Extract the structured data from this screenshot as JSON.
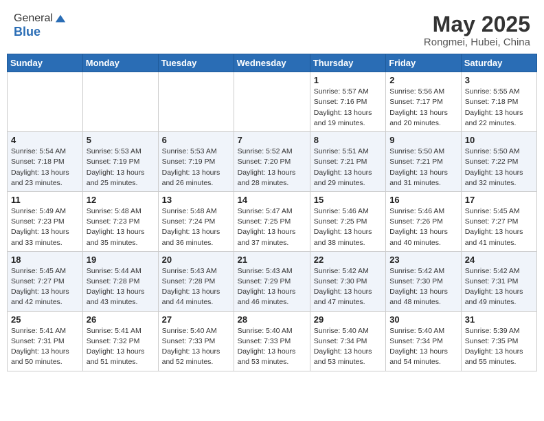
{
  "header": {
    "logo_line1": "General",
    "logo_line2": "Blue",
    "month_title": "May 2025",
    "location": "Rongmei, Hubei, China"
  },
  "days_of_week": [
    "Sunday",
    "Monday",
    "Tuesday",
    "Wednesday",
    "Thursday",
    "Friday",
    "Saturday"
  ],
  "weeks": [
    [
      {
        "day": "",
        "info": ""
      },
      {
        "day": "",
        "info": ""
      },
      {
        "day": "",
        "info": ""
      },
      {
        "day": "",
        "info": ""
      },
      {
        "day": "1",
        "info": "Sunrise: 5:57 AM\nSunset: 7:16 PM\nDaylight: 13 hours\nand 19 minutes."
      },
      {
        "day": "2",
        "info": "Sunrise: 5:56 AM\nSunset: 7:17 PM\nDaylight: 13 hours\nand 20 minutes."
      },
      {
        "day": "3",
        "info": "Sunrise: 5:55 AM\nSunset: 7:18 PM\nDaylight: 13 hours\nand 22 minutes."
      }
    ],
    [
      {
        "day": "4",
        "info": "Sunrise: 5:54 AM\nSunset: 7:18 PM\nDaylight: 13 hours\nand 23 minutes."
      },
      {
        "day": "5",
        "info": "Sunrise: 5:53 AM\nSunset: 7:19 PM\nDaylight: 13 hours\nand 25 minutes."
      },
      {
        "day": "6",
        "info": "Sunrise: 5:53 AM\nSunset: 7:19 PM\nDaylight: 13 hours\nand 26 minutes."
      },
      {
        "day": "7",
        "info": "Sunrise: 5:52 AM\nSunset: 7:20 PM\nDaylight: 13 hours\nand 28 minutes."
      },
      {
        "day": "8",
        "info": "Sunrise: 5:51 AM\nSunset: 7:21 PM\nDaylight: 13 hours\nand 29 minutes."
      },
      {
        "day": "9",
        "info": "Sunrise: 5:50 AM\nSunset: 7:21 PM\nDaylight: 13 hours\nand 31 minutes."
      },
      {
        "day": "10",
        "info": "Sunrise: 5:50 AM\nSunset: 7:22 PM\nDaylight: 13 hours\nand 32 minutes."
      }
    ],
    [
      {
        "day": "11",
        "info": "Sunrise: 5:49 AM\nSunset: 7:23 PM\nDaylight: 13 hours\nand 33 minutes."
      },
      {
        "day": "12",
        "info": "Sunrise: 5:48 AM\nSunset: 7:23 PM\nDaylight: 13 hours\nand 35 minutes."
      },
      {
        "day": "13",
        "info": "Sunrise: 5:48 AM\nSunset: 7:24 PM\nDaylight: 13 hours\nand 36 minutes."
      },
      {
        "day": "14",
        "info": "Sunrise: 5:47 AM\nSunset: 7:25 PM\nDaylight: 13 hours\nand 37 minutes."
      },
      {
        "day": "15",
        "info": "Sunrise: 5:46 AM\nSunset: 7:25 PM\nDaylight: 13 hours\nand 38 minutes."
      },
      {
        "day": "16",
        "info": "Sunrise: 5:46 AM\nSunset: 7:26 PM\nDaylight: 13 hours\nand 40 minutes."
      },
      {
        "day": "17",
        "info": "Sunrise: 5:45 AM\nSunset: 7:27 PM\nDaylight: 13 hours\nand 41 minutes."
      }
    ],
    [
      {
        "day": "18",
        "info": "Sunrise: 5:45 AM\nSunset: 7:27 PM\nDaylight: 13 hours\nand 42 minutes."
      },
      {
        "day": "19",
        "info": "Sunrise: 5:44 AM\nSunset: 7:28 PM\nDaylight: 13 hours\nand 43 minutes."
      },
      {
        "day": "20",
        "info": "Sunrise: 5:43 AM\nSunset: 7:28 PM\nDaylight: 13 hours\nand 44 minutes."
      },
      {
        "day": "21",
        "info": "Sunrise: 5:43 AM\nSunset: 7:29 PM\nDaylight: 13 hours\nand 46 minutes."
      },
      {
        "day": "22",
        "info": "Sunrise: 5:42 AM\nSunset: 7:30 PM\nDaylight: 13 hours\nand 47 minutes."
      },
      {
        "day": "23",
        "info": "Sunrise: 5:42 AM\nSunset: 7:30 PM\nDaylight: 13 hours\nand 48 minutes."
      },
      {
        "day": "24",
        "info": "Sunrise: 5:42 AM\nSunset: 7:31 PM\nDaylight: 13 hours\nand 49 minutes."
      }
    ],
    [
      {
        "day": "25",
        "info": "Sunrise: 5:41 AM\nSunset: 7:31 PM\nDaylight: 13 hours\nand 50 minutes."
      },
      {
        "day": "26",
        "info": "Sunrise: 5:41 AM\nSunset: 7:32 PM\nDaylight: 13 hours\nand 51 minutes."
      },
      {
        "day": "27",
        "info": "Sunrise: 5:40 AM\nSunset: 7:33 PM\nDaylight: 13 hours\nand 52 minutes."
      },
      {
        "day": "28",
        "info": "Sunrise: 5:40 AM\nSunset: 7:33 PM\nDaylight: 13 hours\nand 53 minutes."
      },
      {
        "day": "29",
        "info": "Sunrise: 5:40 AM\nSunset: 7:34 PM\nDaylight: 13 hours\nand 53 minutes."
      },
      {
        "day": "30",
        "info": "Sunrise: 5:40 AM\nSunset: 7:34 PM\nDaylight: 13 hours\nand 54 minutes."
      },
      {
        "day": "31",
        "info": "Sunrise: 5:39 AM\nSunset: 7:35 PM\nDaylight: 13 hours\nand 55 minutes."
      }
    ]
  ]
}
